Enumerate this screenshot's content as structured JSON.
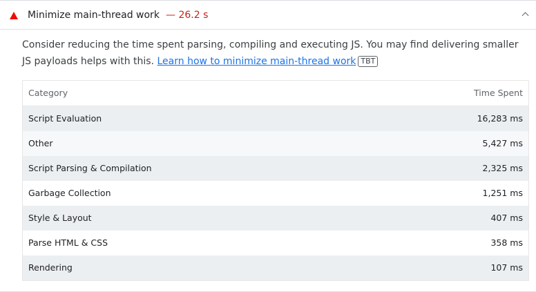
{
  "audit": {
    "title": "Minimize main-thread work",
    "value": "— 26.2 s",
    "status_color": "#eb0f00",
    "description_text": "Consider reducing the time spent parsing, compiling and executing JS. You may find delivering smaller JS payloads helps with this. ",
    "learn_more_link": "Learn how to minimize main-thread work",
    "metric_tag": "TBT"
  },
  "table": {
    "headers": {
      "category": "Category",
      "time_spent": "Time Spent"
    },
    "rows": [
      {
        "category": "Script Evaluation",
        "time": "16,283 ms"
      },
      {
        "category": "Other",
        "time": "5,427 ms"
      },
      {
        "category": "Script Parsing & Compilation",
        "time": "2,325 ms"
      },
      {
        "category": "Garbage Collection",
        "time": "1,251 ms"
      },
      {
        "category": "Style & Layout",
        "time": "407 ms"
      },
      {
        "category": "Parse HTML & CSS",
        "time": "358 ms"
      },
      {
        "category": "Rendering",
        "time": "107 ms"
      }
    ]
  }
}
